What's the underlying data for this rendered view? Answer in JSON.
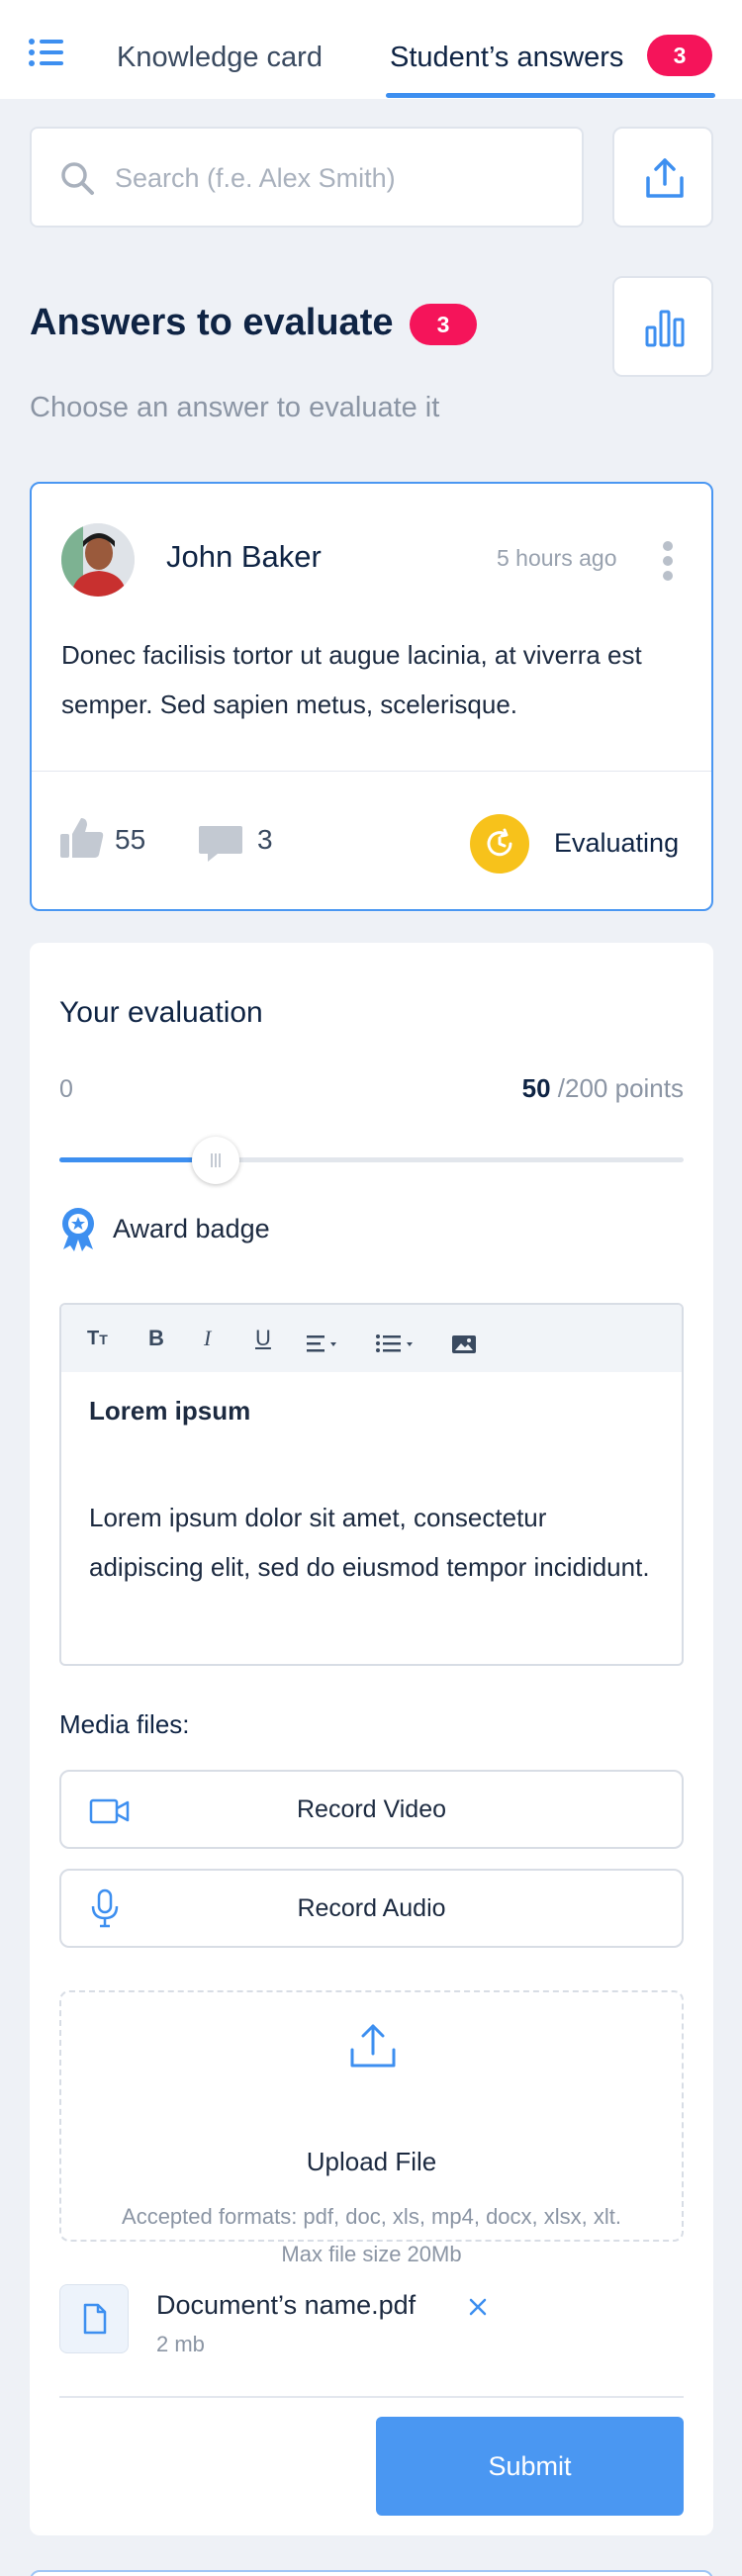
{
  "header": {
    "menu_icon": "list-menu-icon",
    "tabs": [
      {
        "label": "Knowledge card",
        "active": false
      },
      {
        "label": "Student’s answers",
        "active": true,
        "badge": "3"
      }
    ],
    "accent_color": "#3d8ff0",
    "badge_color": "#f5145a"
  },
  "search": {
    "placeholder": "Search (f.e. Alex Smith)",
    "value": ""
  },
  "answers_section": {
    "title": "Answers to evaluate",
    "count": "3",
    "subtitle": "Choose an answer to evaluate it"
  },
  "answer_card": {
    "author": "John Baker",
    "time": "5 hours ago",
    "text": "Donec facilisis tortor ut augue lacinia, at viverra est semper. Sed sapien metus, scelerisque.",
    "likes": "55",
    "comments": "3",
    "status": "Evaluating",
    "status_color": "#f7c21b"
  },
  "evaluation": {
    "title": "Your evaluation",
    "range_min": "0",
    "points_value": "50",
    "points_suffix": "/200 points",
    "score": 50,
    "max": 200,
    "award_label": "Award badge",
    "editor": {
      "toolbar": [
        "text-size-icon",
        "bold-icon",
        "italic-icon",
        "underline-icon",
        "align-icon",
        "list-icon",
        "image-icon"
      ],
      "heading": "Lorem ipsum",
      "body": "Lorem ipsum dolor sit amet, consectetur adipiscing elit, sed do eiusmod tempor incididunt."
    },
    "media_title": "Media files:",
    "record_video": "Record Video",
    "record_audio": "Record Audio",
    "upload": {
      "title": "Upload File",
      "formats": "Accepted formats: pdf, doc, xls, mp4, docx, xlsx, xlt.",
      "max_size": "Max file size 20Mb"
    },
    "file": {
      "name": "Document’s name.pdf",
      "size": "2 mb"
    },
    "submit": "Submit"
  }
}
